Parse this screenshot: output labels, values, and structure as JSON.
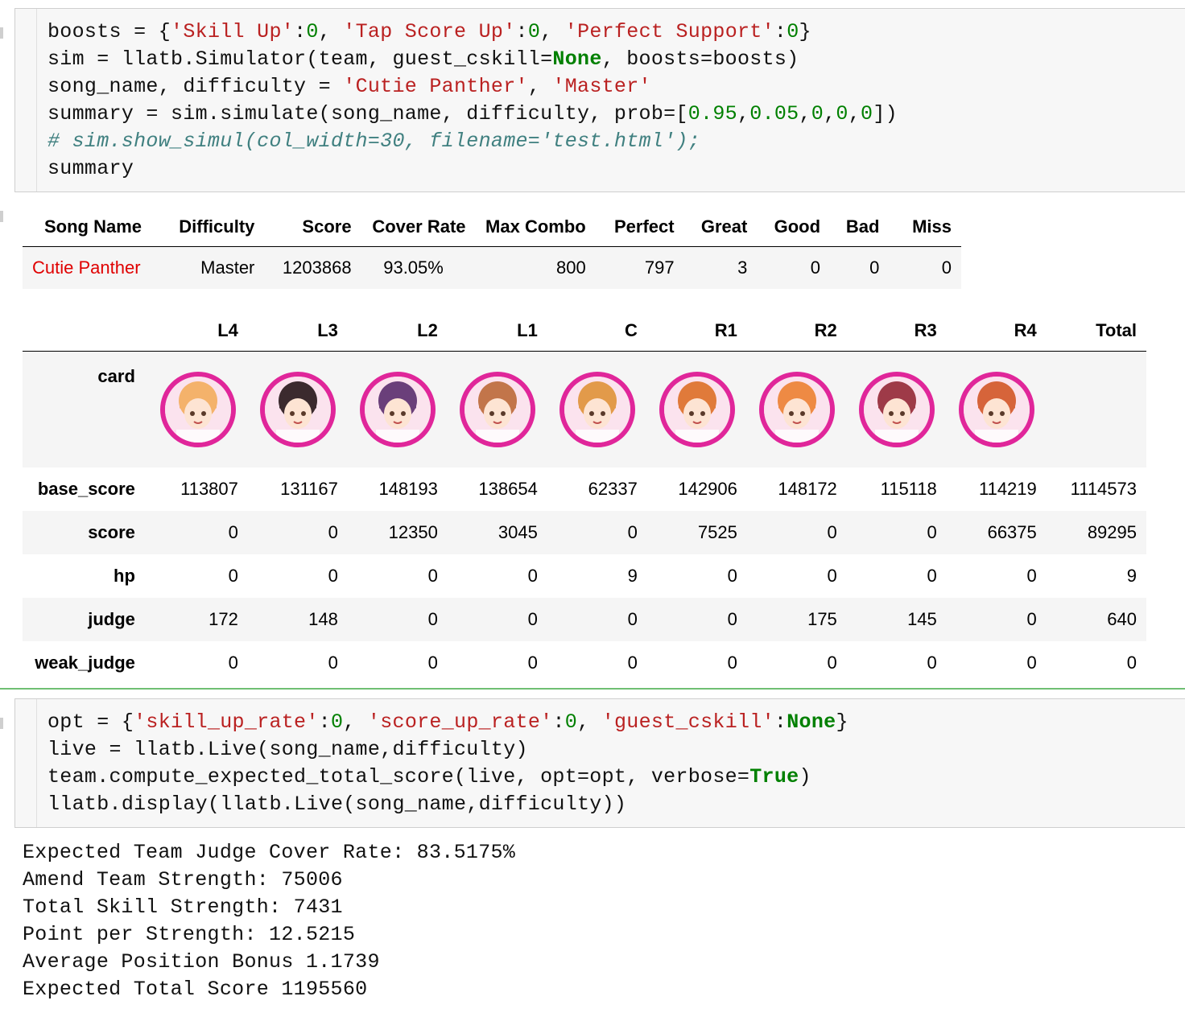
{
  "cell1": {
    "lines": [
      [
        {
          "t": "boosts = {",
          "c": ""
        },
        {
          "t": "'Skill Up'",
          "c": "str"
        },
        {
          "t": ":",
          "c": ""
        },
        {
          "t": "0",
          "c": "num"
        },
        {
          "t": ", ",
          "c": ""
        },
        {
          "t": "'Tap Score Up'",
          "c": "str"
        },
        {
          "t": ":",
          "c": ""
        },
        {
          "t": "0",
          "c": "num"
        },
        {
          "t": ", ",
          "c": ""
        },
        {
          "t": "'Perfect Support'",
          "c": "str"
        },
        {
          "t": ":",
          "c": ""
        },
        {
          "t": "0",
          "c": "num"
        },
        {
          "t": "}",
          "c": ""
        }
      ],
      [
        {
          "t": "sim = llatb.Simulator(team, guest_cskill=",
          "c": ""
        },
        {
          "t": "None",
          "c": "kw"
        },
        {
          "t": ", boosts=boosts)",
          "c": ""
        }
      ],
      [
        {
          "t": "song_name, difficulty = ",
          "c": ""
        },
        {
          "t": "'Cutie Panther'",
          "c": "str"
        },
        {
          "t": ", ",
          "c": ""
        },
        {
          "t": "'Master'",
          "c": "str"
        }
      ],
      [
        {
          "t": "summary = sim.simulate(song_name, difficulty, prob=[",
          "c": ""
        },
        {
          "t": "0.95",
          "c": "num"
        },
        {
          "t": ",",
          "c": ""
        },
        {
          "t": "0.05",
          "c": "num"
        },
        {
          "t": ",",
          "c": ""
        },
        {
          "t": "0",
          "c": "num"
        },
        {
          "t": ",",
          "c": ""
        },
        {
          "t": "0",
          "c": "num"
        },
        {
          "t": ",",
          "c": ""
        },
        {
          "t": "0",
          "c": "num"
        },
        {
          "t": "])",
          "c": ""
        }
      ],
      [
        {
          "t": "# sim.show_simul(col_width=30, filename='test.html');",
          "c": "cm"
        }
      ],
      [
        {
          "t": "summary",
          "c": ""
        }
      ]
    ]
  },
  "summary": {
    "headers": [
      "Song Name",
      "Difficulty",
      "Score",
      "Cover Rate",
      "Max Combo",
      "Perfect",
      "Great",
      "Good",
      "Bad",
      "Miss"
    ],
    "row": [
      "Cutie Panther",
      "Master",
      "1203868",
      "93.05%",
      "800",
      "797",
      "3",
      "0",
      "0",
      "0"
    ]
  },
  "cards": {
    "columns": [
      "L4",
      "L3",
      "L2",
      "L1",
      "C",
      "R1",
      "R2",
      "R3",
      "R4",
      "Total"
    ],
    "card_label": "card",
    "avatar_colors": [
      "#f4b26b",
      "#3b2a2e",
      "#6a3f7a",
      "#c2754a",
      "#e29a4a",
      "#e07a3a",
      "#ee8a44",
      "#9e3a48",
      "#d6643a"
    ],
    "rows": [
      {
        "label": "base_score",
        "values": [
          "113807",
          "131167",
          "148193",
          "138654",
          "62337",
          "142906",
          "148172",
          "115118",
          "114219",
          "1114573"
        ]
      },
      {
        "label": "score",
        "values": [
          "0",
          "0",
          "12350",
          "3045",
          "0",
          "7525",
          "0",
          "0",
          "66375",
          "89295"
        ]
      },
      {
        "label": "hp",
        "values": [
          "0",
          "0",
          "0",
          "0",
          "9",
          "0",
          "0",
          "0",
          "0",
          "9"
        ]
      },
      {
        "label": "judge",
        "values": [
          "172",
          "148",
          "0",
          "0",
          "0",
          "0",
          "175",
          "145",
          "0",
          "640"
        ]
      },
      {
        "label": "weak_judge",
        "values": [
          "0",
          "0",
          "0",
          "0",
          "0",
          "0",
          "0",
          "0",
          "0",
          "0"
        ]
      }
    ]
  },
  "cell2": {
    "lines": [
      [
        {
          "t": "opt = {",
          "c": ""
        },
        {
          "t": "'skill_up_rate'",
          "c": "str"
        },
        {
          "t": ":",
          "c": ""
        },
        {
          "t": "0",
          "c": "num"
        },
        {
          "t": ", ",
          "c": ""
        },
        {
          "t": "'score_up_rate'",
          "c": "str"
        },
        {
          "t": ":",
          "c": ""
        },
        {
          "t": "0",
          "c": "num"
        },
        {
          "t": ", ",
          "c": ""
        },
        {
          "t": "'guest_cskill'",
          "c": "str"
        },
        {
          "t": ":",
          "c": ""
        },
        {
          "t": "None",
          "c": "kw"
        },
        {
          "t": "}",
          "c": ""
        }
      ],
      [
        {
          "t": "live = llatb.Live(song_name,difficulty)",
          "c": ""
        }
      ],
      [
        {
          "t": "team.compute_expected_total_score(live, opt=opt, verbose=",
          "c": ""
        },
        {
          "t": "True",
          "c": "kw"
        },
        {
          "t": ")",
          "c": ""
        }
      ],
      [
        {
          "t": "llatb.display(llatb.Live(song_name,difficulty))",
          "c": ""
        }
      ]
    ]
  },
  "output": {
    "lines": [
      "Expected Team Judge Cover Rate: 83.5175%",
      "Amend Team Strength: 75006",
      "Total Skill Strength: 7431",
      "Point per Strength: 12.5215",
      "Average Position Bonus 1.1739",
      "Expected Total Score 1195560"
    ]
  }
}
